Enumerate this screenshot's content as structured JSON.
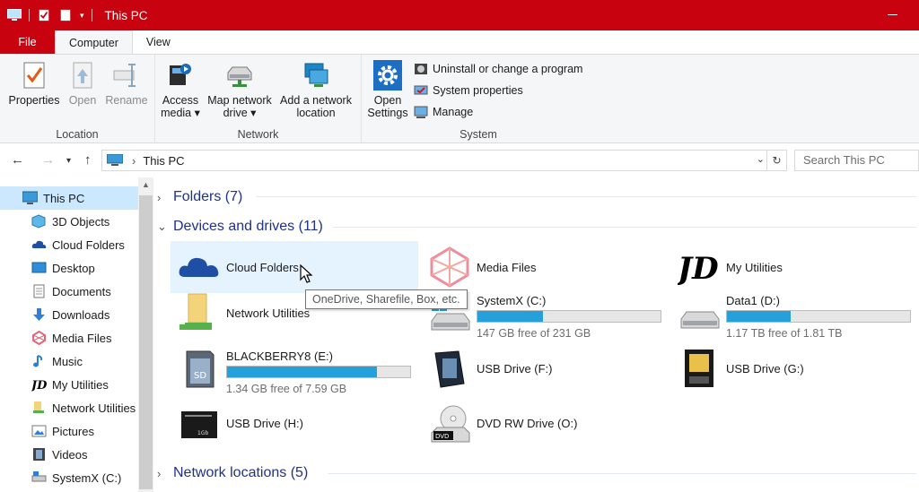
{
  "window": {
    "title": "This PC"
  },
  "ribbon": {
    "tabs": [
      "File",
      "Computer",
      "View"
    ],
    "location": {
      "label": "Location",
      "properties": "Properties",
      "open": "Open",
      "rename": "Rename"
    },
    "network": {
      "label": "Network",
      "access_media_1": "Access",
      "access_media_2": "media ▾",
      "map_drive_1": "Map network",
      "map_drive_2": "drive ▾",
      "add_location_1": "Add a network",
      "add_location_2": "location"
    },
    "system": {
      "label": "System",
      "open_settings_1": "Open",
      "open_settings_2": "Settings",
      "uninstall": "Uninstall or change a program",
      "system_properties": "System properties",
      "manage": "Manage"
    }
  },
  "address": {
    "crumb": "This PC",
    "search_placeholder": "Search This PC"
  },
  "nav_pane": {
    "items": [
      {
        "label": "This PC",
        "icon": "pc-icon"
      },
      {
        "label": "3D Objects",
        "icon": "cube-icon"
      },
      {
        "label": "Cloud Folders",
        "icon": "cloud-icon"
      },
      {
        "label": "Desktop",
        "icon": "desktop-icon"
      },
      {
        "label": "Documents",
        "icon": "documents-icon"
      },
      {
        "label": "Downloads",
        "icon": "download-arrow-icon"
      },
      {
        "label": "Media Files",
        "icon": "media-icon"
      },
      {
        "label": "Music",
        "icon": "music-note-icon"
      },
      {
        "label": "My Utilities",
        "icon": "utilities-logo-icon"
      },
      {
        "label": "Network Utilities",
        "icon": "folder-icon"
      },
      {
        "label": "Pictures",
        "icon": "pictures-icon"
      },
      {
        "label": "Videos",
        "icon": "videos-icon"
      },
      {
        "label": "SystemX (C:)",
        "icon": "drive-icon"
      }
    ]
  },
  "content": {
    "folders_header": "Folders (7)",
    "devices_header": "Devices and drives (11)",
    "network_header": "Network locations (5)",
    "tooltip": "OneDrive, Sharefile, Box, etc.",
    "tiles": [
      {
        "name": "Cloud Folders",
        "icon": "cloud-icon"
      },
      {
        "name": "Media Files",
        "icon": "media-icon"
      },
      {
        "name": "My Utilities",
        "icon": "utilities-logo-icon"
      },
      {
        "name": "Network Utilities",
        "icon": "network-folder-icon"
      },
      {
        "name": "SystemX (C:)",
        "icon": "windows-drive-icon",
        "free": "147 GB free of 231 GB",
        "used_fraction": 0.36
      },
      {
        "name": "Data1 (D:)",
        "icon": "drive-icon",
        "free": "1.17 TB free of 1.81 TB",
        "used_fraction": 0.35
      },
      {
        "name": "BLACKBERRY8 (E:)",
        "icon": "sd-card-icon",
        "free": "1.34 GB free of 7.59 GB",
        "used_fraction": 0.82
      },
      {
        "name": "USB Drive (F:)",
        "icon": "memory-card-icon"
      },
      {
        "name": "USB Drive (G:)",
        "icon": "smart-card-icon"
      },
      {
        "name": "USB Drive (H:)",
        "icon": "memory-stick-icon"
      },
      {
        "name": "DVD RW Drive (O:)",
        "icon": "dvd-drive-icon"
      }
    ]
  },
  "colors": {
    "titlebar": "#c8030f",
    "accent": "#26a0da",
    "section_text": "#1e3287",
    "selection": "#cce8ff",
    "hover": "#e5f3ff"
  }
}
